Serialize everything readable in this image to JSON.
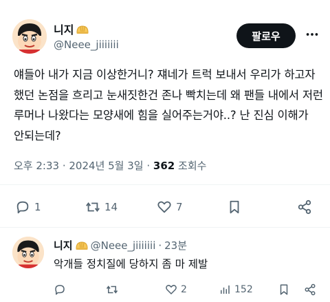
{
  "author": {
    "name": "니지",
    "handle": "@Neee_jiiiiiii",
    "badge_icon": "bun-emoji-icon",
    "avatar_icon": "cartoon-boy-avatar"
  },
  "follow_label": "팔로우",
  "more_icon": "more-dots-icon",
  "tweet": {
    "text": "얘들아 내가 지금 이상한거니? 쟤네가 트럭 보내서 우리가 하고자 했던 논점을 흐리고 눈새짓한건 존나 빡치는데 왜 팬들 내에서 저런 루머나 나왔다는 모양새에 힘을 실어주는거야..? 난 진심 이해가 안되는데?",
    "time": "오후 2:33",
    "date": "2024년 5월 3일",
    "views": "362",
    "views_label": "조회수"
  },
  "actions": {
    "replies": "1",
    "retweets": "14",
    "likes": "7"
  },
  "reply": {
    "name": "니지",
    "handle": "@Neee_jiiiiiii",
    "age": "23분",
    "text": "악개들 정치질에 당하지 좀 마 제발",
    "views": "152",
    "likes": "2"
  },
  "colors": {
    "text": "#0f1419",
    "secondary": "#536471",
    "button_bg": "#0f1419",
    "divider": "#eff3f4"
  }
}
